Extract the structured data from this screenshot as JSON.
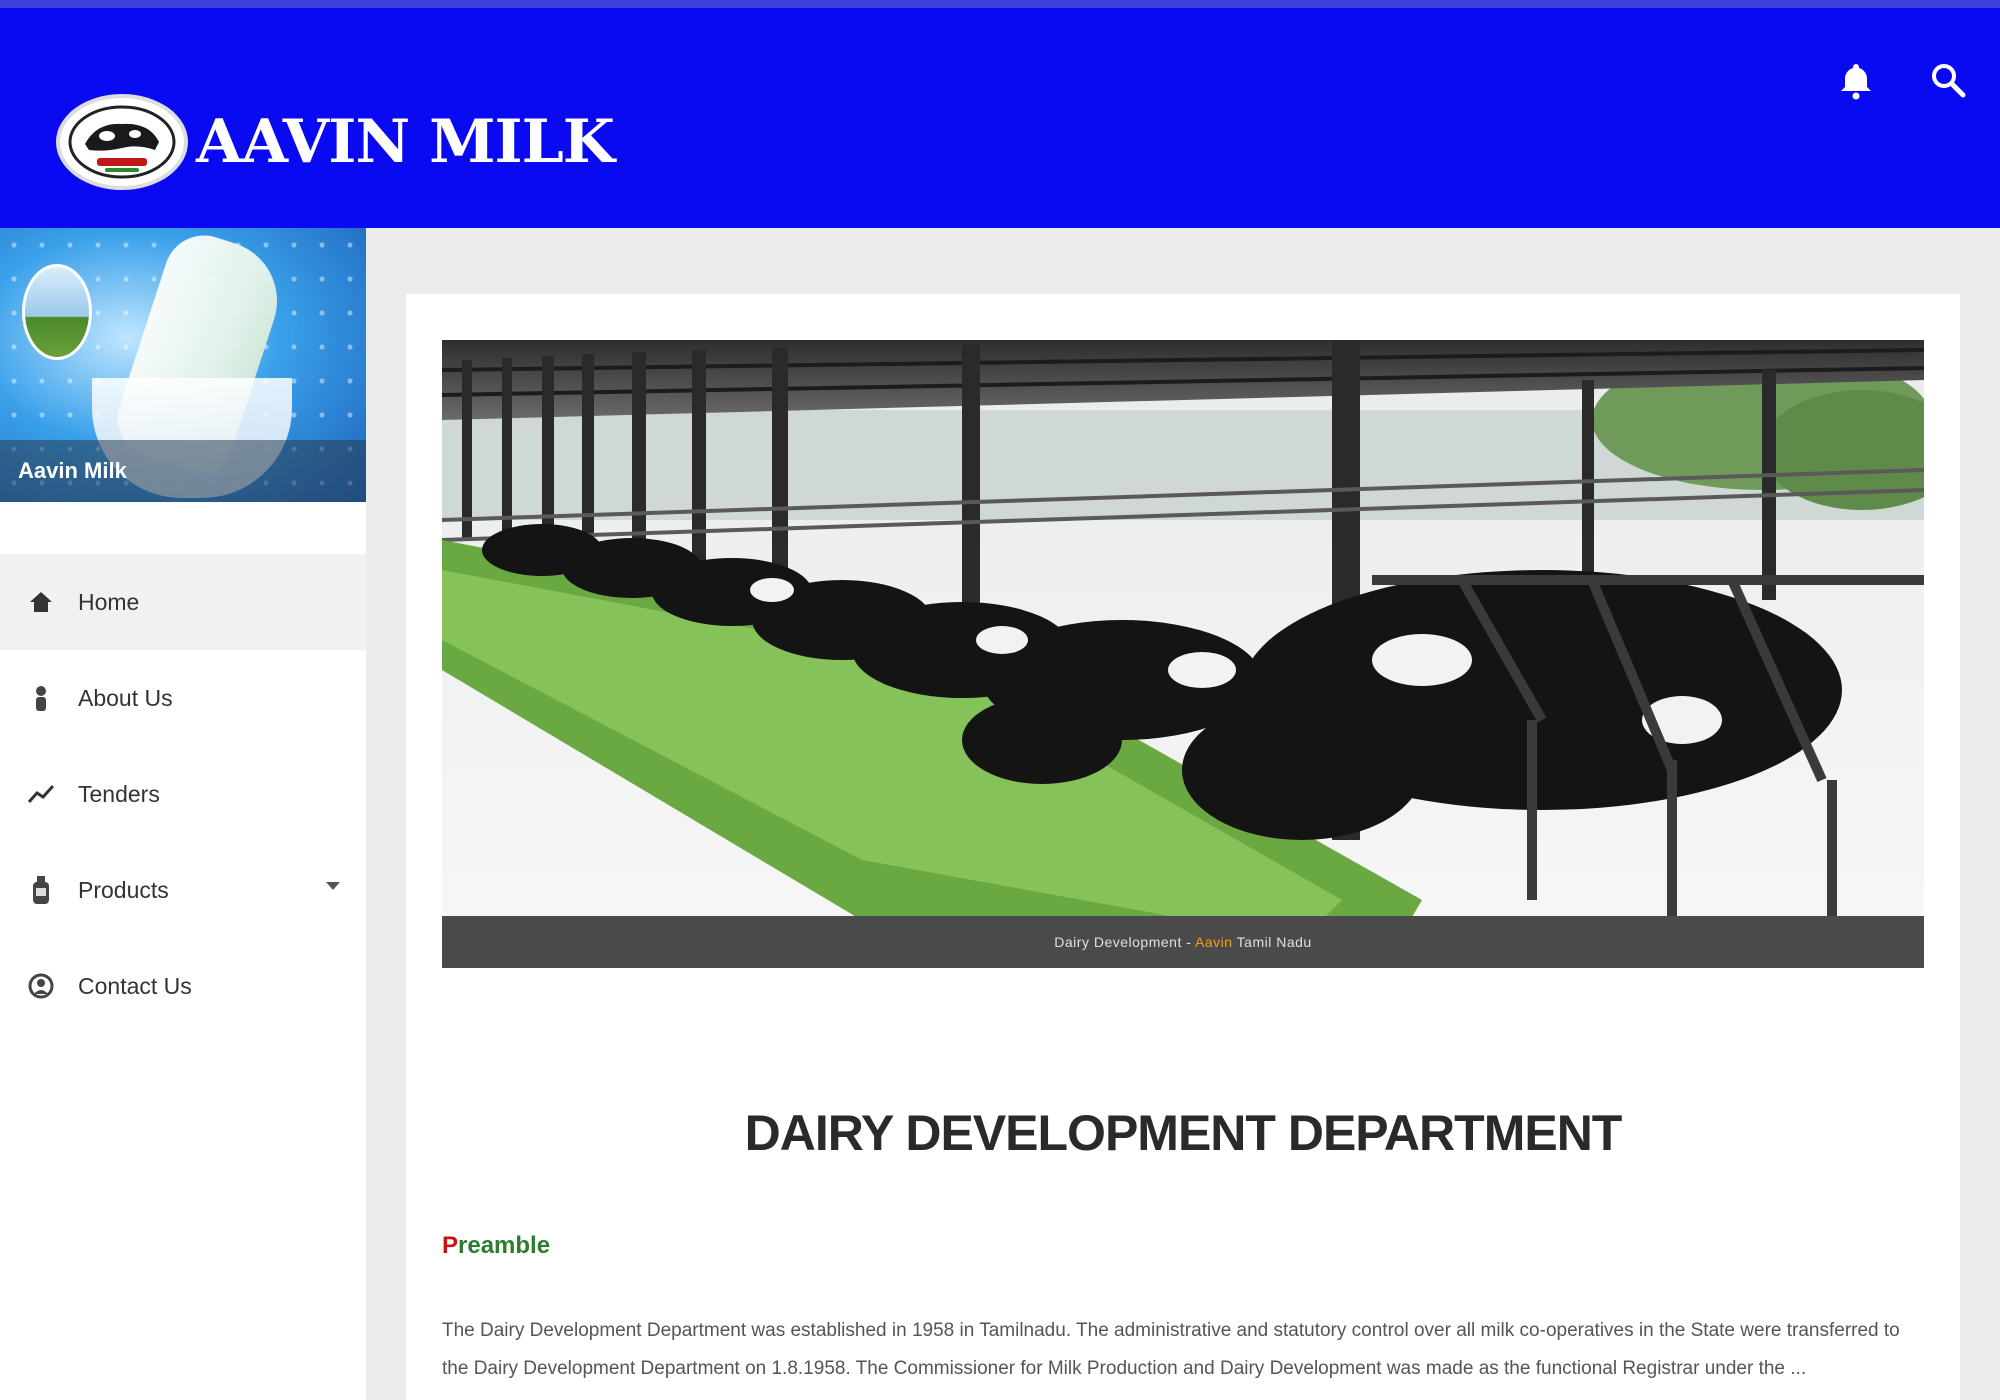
{
  "header": {
    "logo_text": "AAVIN MILK",
    "icons": {
      "notification": "bell-icon",
      "search": "search-icon"
    },
    "color": "#0a0af2"
  },
  "sidebar": {
    "banner_name": "Aavin Milk",
    "items": [
      {
        "label": "Home",
        "icon": "home-icon",
        "active": true
      },
      {
        "label": "About Us",
        "icon": "person-icon"
      },
      {
        "label": "Tenders",
        "icon": "chart-line-icon"
      },
      {
        "label": "Products",
        "icon": "bottle-icon",
        "has_submenu": true
      },
      {
        "label": "Contact Us",
        "icon": "contact-icon"
      }
    ]
  },
  "main": {
    "hero_caption_prefix": "Dairy Development - ",
    "hero_caption_highlight": "Aavin",
    "hero_caption_suffix": " Tamil Nadu",
    "title": "DAIRY DEVELOPMENT DEPARTMENT",
    "section_heading": "Preamble",
    "paragraph": "The Dairy Development Department was established in 1958 in Tamilnadu. The administrative and statutory control over all milk co-operatives in the State were transferred to the Dairy Development Department on 1.8.1958. The Commissioner for Milk Production and Dairy Development was made as the functional Registrar under the ..."
  },
  "colors": {
    "accent": "#0a0af2",
    "heading_green": "#2e7d2e",
    "heading_red": "#c81414"
  }
}
